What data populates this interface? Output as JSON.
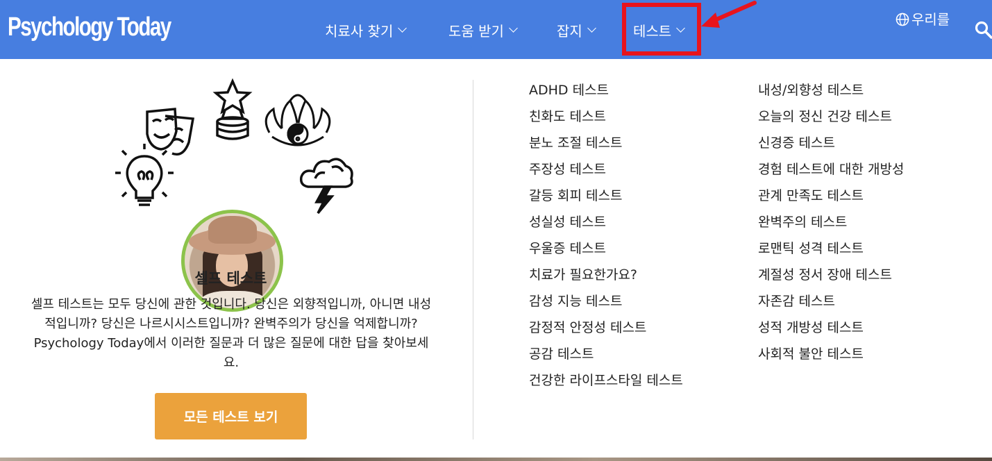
{
  "header": {
    "logo": "Psychology Today",
    "nav": [
      {
        "label": "치료사 찾기"
      },
      {
        "label": "도움 받기"
      },
      {
        "label": "잡지"
      },
      {
        "label": "테스트"
      }
    ],
    "language": "우리를",
    "highlight_color": "#e8141c",
    "bar_color": "#477ee0"
  },
  "self_test": {
    "title": "셀프 테스트",
    "description": "셀프 테스트는 모두 당신에 관한 것입니다. 당신은 외향적입니까, 아니면 내성적입니까? 당신은 나르시시스트입니까? 완벽주의가 당신을 억제합니까? Psychology Today에서 이러한 질문과 더 많은 질문에 대한 답을 찾아보세요.",
    "button": "모든 테스트 보기",
    "button_color": "#eba23c",
    "icons": [
      "theater-masks-icon",
      "star-trophy-icon",
      "lotus-yin-yang-icon",
      "lightbulb-icon",
      "storm-cloud-icon"
    ]
  },
  "tests": {
    "column1": [
      "ADHD 테스트",
      "친화도 테스트",
      "분노 조절 테스트",
      "주장성 테스트",
      "갈등 회피 테스트",
      "성실성 테스트",
      "우울증 테스트",
      "치료가 필요한가요?",
      "감성 지능 테스트",
      "감정적 안정성 테스트",
      "공감 테스트",
      "건강한 라이프스타일 테스트"
    ],
    "column2": [
      "내성/외향성 테스트",
      "오늘의 정신 건강 테스트",
      "신경증 테스트",
      "경험 테스트에 대한 개방성",
      "관계 만족도 테스트",
      "완벽주의 테스트",
      "로맨틱 성격 테스트",
      "계절성 정서 장애 테스트",
      "자존감 테스트",
      "성적 개방성 테스트",
      "사회적 불안 테스트"
    ]
  }
}
